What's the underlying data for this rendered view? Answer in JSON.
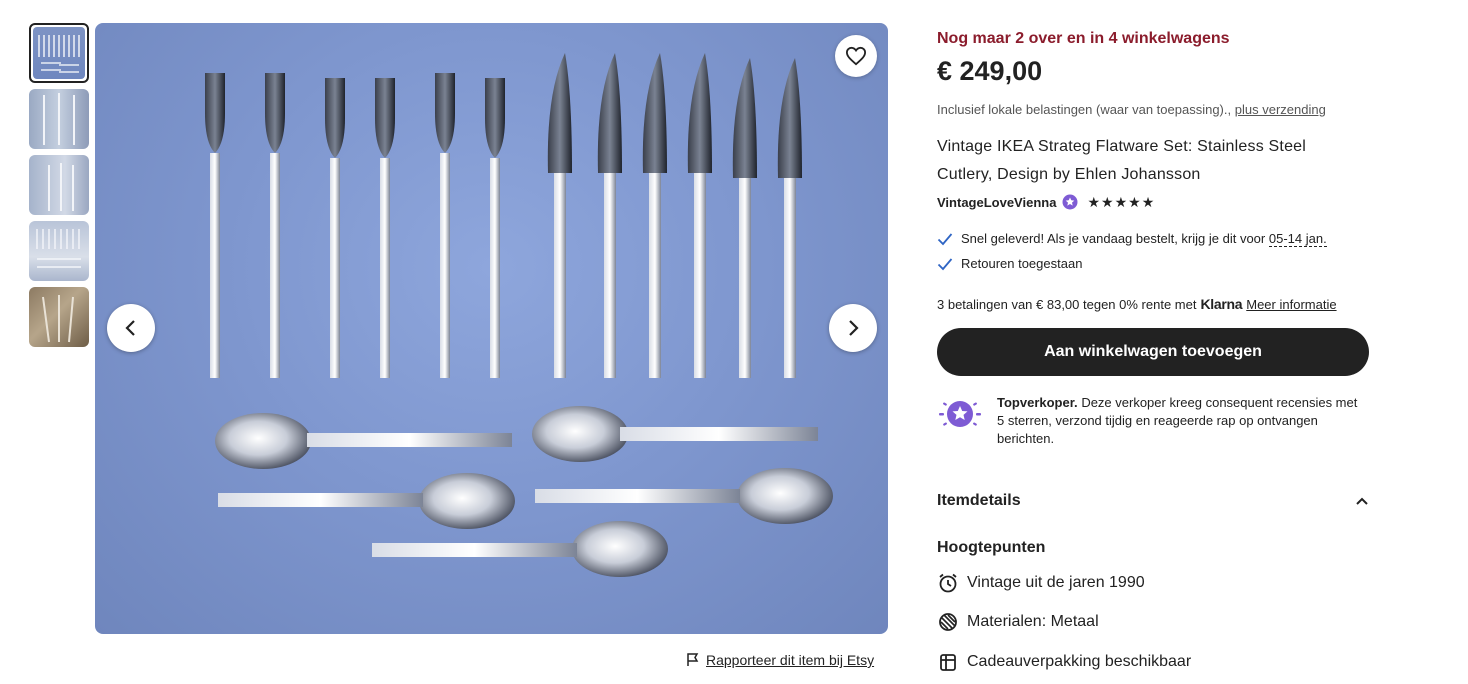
{
  "gallery": {
    "thumbnails": [
      "thumbnail-1",
      "thumbnail-2",
      "thumbnail-3",
      "thumbnail-4",
      "thumbnail-5"
    ],
    "active_index": 0,
    "report_label": "Rapporteer dit item bij Etsy"
  },
  "listing": {
    "stock_notice": "Nog maar 2 over en in 4 winkelwagens",
    "price": "€ 249,00",
    "tax_text": "Inclusief lokale belastingen (waar van toepassing).,",
    "shipping_link": "plus verzending",
    "title": "Vintage IKEA Strateg Flatware Set: Stainless Steel Cutlery, Design by Ehlen Johansson",
    "seller_name": "VintageLoveVienna",
    "rating_stars": 5
  },
  "delivery": {
    "fast_text": "Snel geleverd! Als je vandaag bestelt, krijg je dit voor",
    "fast_date": "05-14 jan.",
    "returns_text": "Retouren toegestaan"
  },
  "payment": {
    "installments_text": "3 betalingen van € 83,00 tegen 0% rente met",
    "provider": "Klarna",
    "more_link": "Meer informatie"
  },
  "cart_button": "Aan winkelwagen toevoegen",
  "topseller": {
    "title": "Topverkoper.",
    "text": "Deze verkoper kreeg consequent recensies met 5 sterren, verzond tijdig en reageerde rap op ontvangen berichten."
  },
  "details": {
    "header": "Itemdetails",
    "highlights_title": "Hoogtepunten",
    "items": [
      {
        "icon": "alarm-clock-icon",
        "label": "Vintage uit de jaren 1990"
      },
      {
        "icon": "materials-icon",
        "label": "Materialen: Metaal"
      },
      {
        "icon": "gift-wrap-icon",
        "label": "Cadeauverpakking beschikbaar"
      }
    ]
  },
  "colors": {
    "stock_notice": "#8b1c2c",
    "button_bg": "#222222",
    "star_badge": "#7e5bd4",
    "check": "#2f65c4"
  }
}
